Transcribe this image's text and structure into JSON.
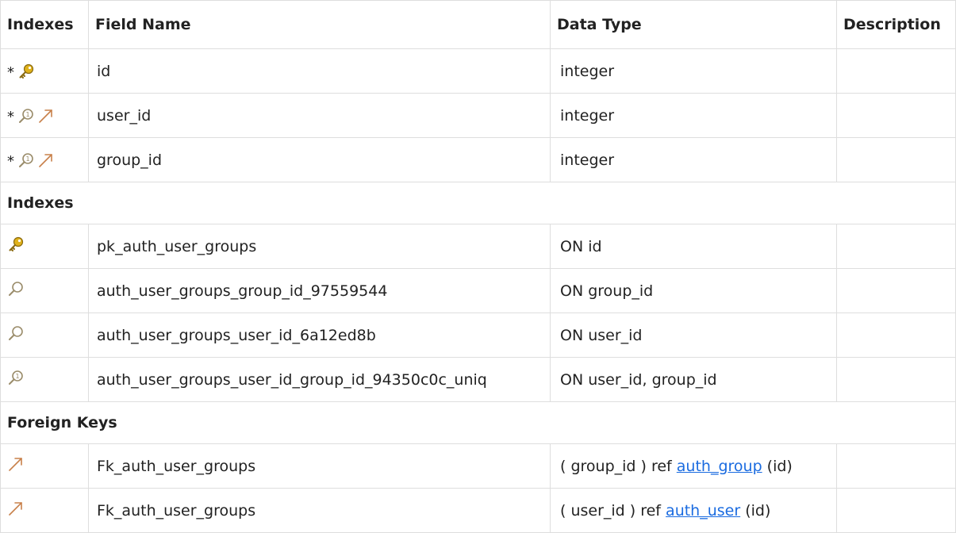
{
  "headers": {
    "indexes": "Indexes",
    "field_name": "Field Name",
    "data_type": "Data Type",
    "description": "Description"
  },
  "fields": [
    {
      "mark": "*",
      "icon": "primary-key-icon",
      "name": "id",
      "type": "integer",
      "description": ""
    },
    {
      "mark": "*",
      "icon": "index-fk-icon",
      "name": "user_id",
      "type": "integer",
      "description": ""
    },
    {
      "mark": "*",
      "icon": "index-fk-icon",
      "name": "group_id",
      "type": "integer",
      "description": ""
    }
  ],
  "indexes_section": {
    "label": "Indexes",
    "items": [
      {
        "icon": "primary-key-icon",
        "name": "pk_auth_user_groups",
        "on": "ON id"
      },
      {
        "icon": "index-icon",
        "name": "auth_user_groups_group_id_97559544",
        "on": "ON group_id"
      },
      {
        "icon": "index-icon",
        "name": "auth_user_groups_user_id_6a12ed8b",
        "on": "ON user_id"
      },
      {
        "icon": "unique-index-icon",
        "name": "auth_user_groups_user_id_group_id_94350c0c_uniq",
        "on": "ON user_id, group_id"
      }
    ]
  },
  "foreign_keys_section": {
    "label": "Foreign Keys",
    "items": [
      {
        "icon": "foreign-key-icon",
        "name": "Fk_auth_user_groups",
        "pre": "( group_id ) ref ",
        "ref": "auth_group",
        "post": " (id)"
      },
      {
        "icon": "foreign-key-icon",
        "name": "Fk_auth_user_groups",
        "pre": "( user_id ) ref ",
        "ref": "auth_user",
        "post": " (id)"
      }
    ]
  },
  "colors": {
    "key_gold": "#e0b21a",
    "magnifier": "#9a8c6a",
    "arrow": "#c8804a",
    "link": "#1a6be0",
    "border": "#dedede"
  }
}
